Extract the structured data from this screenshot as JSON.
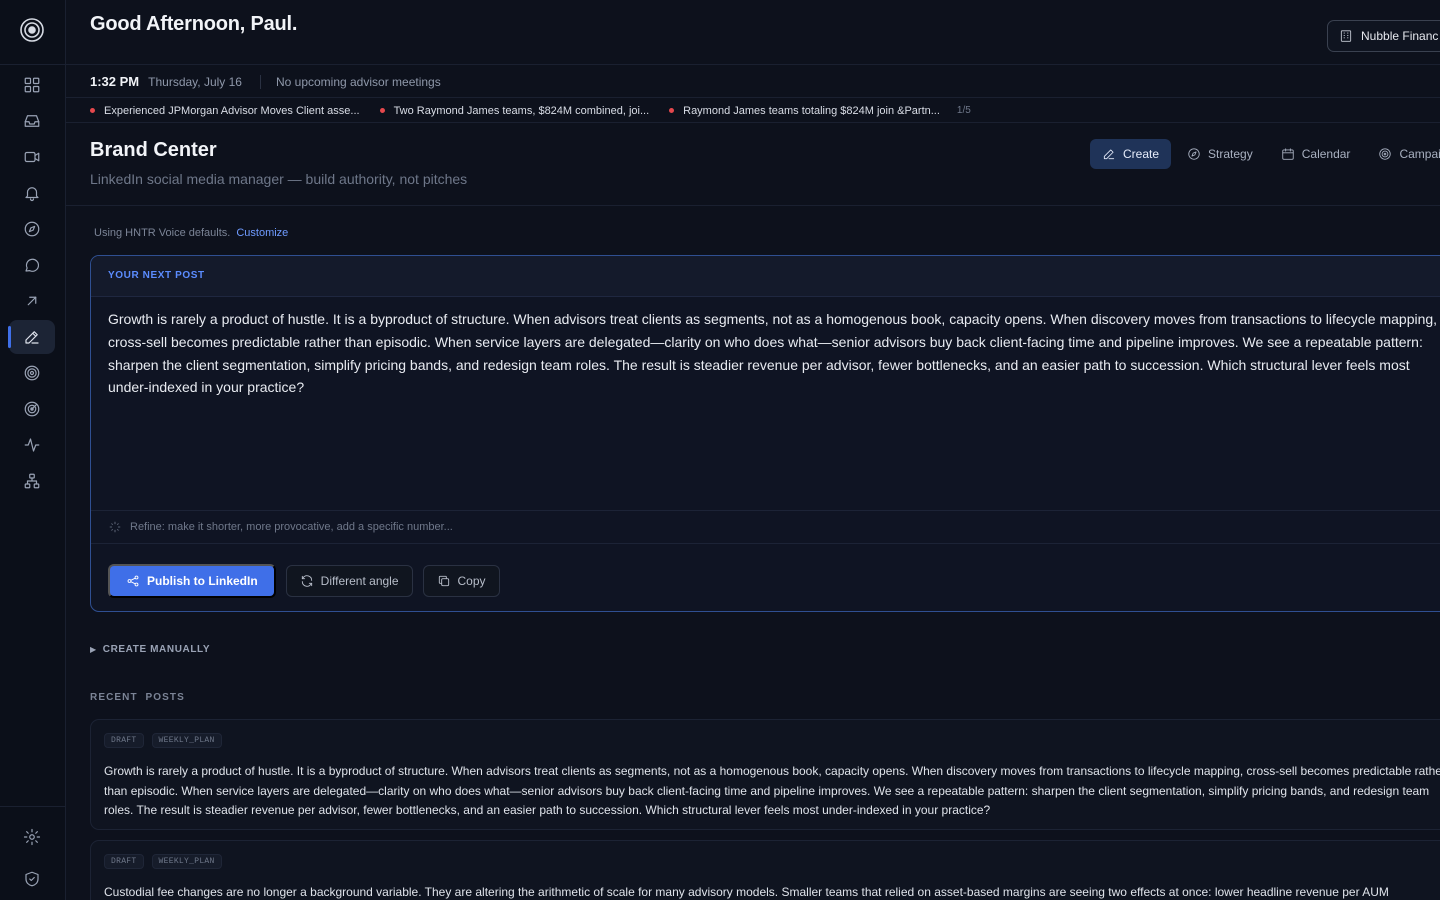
{
  "sidebar": {
    "items": [
      {
        "icon": "dashboard-icon",
        "label": "Dashboard"
      },
      {
        "icon": "inbox-icon",
        "label": "Inbox"
      },
      {
        "icon": "video-icon",
        "label": "Meetings"
      },
      {
        "icon": "bell-icon",
        "label": "Alerts"
      },
      {
        "icon": "compass-icon",
        "label": "Discover"
      },
      {
        "icon": "chat-icon",
        "label": "Messages"
      },
      {
        "icon": "arrow-up-right-icon",
        "label": "Outreach"
      },
      {
        "icon": "edit-icon",
        "label": "Brand Center"
      },
      {
        "icon": "target-icon",
        "label": "Targets"
      },
      {
        "icon": "radar-icon",
        "label": "Prospecting"
      },
      {
        "icon": "activity-icon",
        "label": "Activity"
      },
      {
        "icon": "org-chart-icon",
        "label": "Team"
      }
    ],
    "active_index": 7
  },
  "header": {
    "greeting": "Good Afternoon, Paul.",
    "org_name": "Nubble Financ"
  },
  "status": {
    "time": "1:32 PM",
    "date": "Thursday, July 16",
    "meetings": "No upcoming advisor meetings"
  },
  "ticker": {
    "items": [
      "Experienced JPMorgan Advisor Moves Client asse...",
      "Two Raymond James teams, $824M combined, joi...",
      "Raymond James teams totaling $824M join &Partn..."
    ],
    "count": "1/5",
    "dot_color": "#e5484d"
  },
  "brand_center": {
    "title": "Brand Center",
    "subtitle": "LinkedIn social media manager — build authority, not pitches",
    "tabs": [
      {
        "label": "Create",
        "icon": "edit-icon",
        "active": true
      },
      {
        "label": "Strategy",
        "icon": "compass-icon",
        "active": false
      },
      {
        "label": "Calendar",
        "icon": "calendar-icon",
        "active": false
      },
      {
        "label": "Campaig",
        "icon": "target-icon",
        "active": false
      }
    ]
  },
  "voice": {
    "text": "Using HNTR Voice defaults.",
    "link": "Customize"
  },
  "next_post": {
    "label": "YOUR NEXT POST",
    "body": "Growth is rarely a product of hustle. It is a byproduct of structure. When advisors treat clients as segments, not as a homogenous book, capacity opens. When discovery moves from transactions to lifecycle mapping, cross-sell becomes predictable rather than episodic. When service layers are delegated—clarity on who does what—senior advisors buy back client-facing time and pipeline improves. We see a repeatable pattern: sharpen the client segmentation, simplify pricing bands, and redesign team roles. The result is steadier revenue per advisor, fewer bottlenecks, and an easier path to succession. Which structural lever feels most under-indexed in your practice?",
    "refine_placeholder": "Refine: make it shorter, more provocative, add a specific number...",
    "publish_label": "Publish to LinkedIn",
    "angle_label": "Different angle",
    "copy_label": "Copy",
    "accent": "#3f6fe8"
  },
  "create_manually": "CREATE MANUALLY",
  "recent": {
    "label": "RECENT  POSTS",
    "posts": [
      {
        "tags": [
          "DRAFT",
          "WEEKLY_PLAN"
        ],
        "text": "Growth is rarely a product of hustle. It is a byproduct of structure. When advisors treat clients as segments, not as a homogenous book, capacity opens. When discovery moves from transactions to lifecycle mapping, cross-sell becomes predictable rather than episodic. When service layers are delegated—clarity on who does what—senior advisors buy back client-facing time and pipeline improves. We see a repeatable pattern: sharpen the client segmentation, simplify pricing bands, and redesign team roles. The result is steadier revenue per advisor, fewer bottlenecks, and an easier path to succession. Which structural lever feels most under-indexed in your practice?"
      },
      {
        "tags": [
          "DRAFT",
          "WEEKLY_PLAN"
        ],
        "text": "Custodial fee changes are no longer a background variable. They are altering the arithmetic of scale for many advisory models. Smaller teams that relied on asset-based margins are seeing two effects at once: lower headline revenue per AUM"
      }
    ]
  }
}
